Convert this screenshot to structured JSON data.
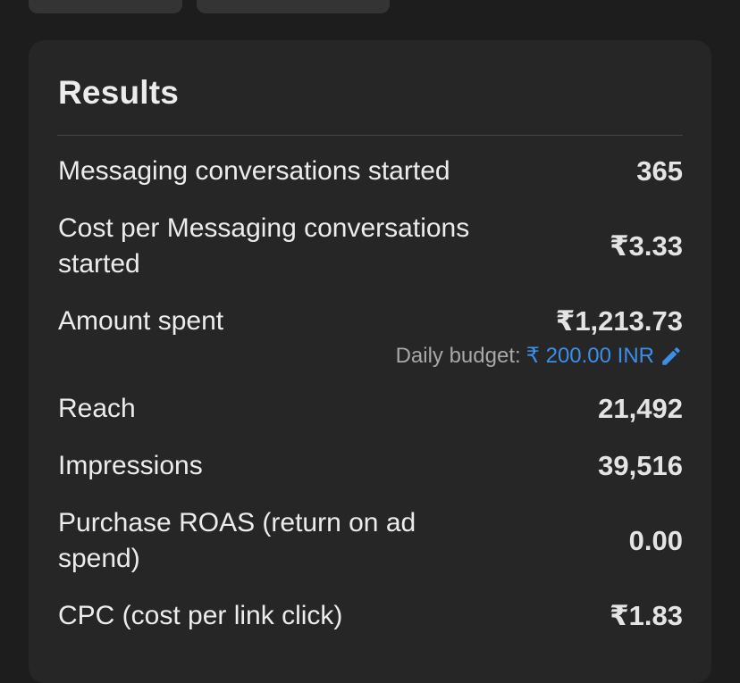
{
  "results": {
    "title": "Results",
    "metrics": [
      {
        "label": "Messaging conversations started",
        "value": "365"
      },
      {
        "label": "Cost per Messaging conversations started",
        "value": "₹3.33"
      },
      {
        "label": "Amount spent",
        "value": "₹1,213.73"
      },
      {
        "label": "Reach",
        "value": "21,492"
      },
      {
        "label": "Impressions",
        "value": "39,516"
      },
      {
        "label": "Purchase ROAS (return on ad spend)",
        "value": "0.00"
      },
      {
        "label": "CPC (cost per link click)",
        "value": "₹1.83"
      }
    ],
    "budget": {
      "label": "Daily budget:",
      "value": "₹ 200.00 INR",
      "edit_icon": "pencil-icon"
    }
  },
  "colors": {
    "background": "#1d1d1d",
    "card": "#262626",
    "accent": "#3b8fe8"
  }
}
